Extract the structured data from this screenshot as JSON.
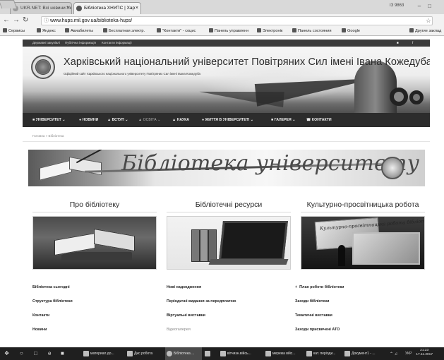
{
  "browser": {
    "tabs": [
      {
        "label": "UKR.NET: Всі новини Ук",
        "active": false
      },
      {
        "label": "Бібліотека ХНУПС | Хар",
        "active": true
      }
    ],
    "user_label": "ІЗ 9863",
    "url": "www.hups.mil.gov.ua/biblioteka-hups/",
    "bookmarks": [
      "Сервисы",
      "Яндекс",
      "Авиабилеты",
      "Бесплатная электр.",
      "\"Контакти\" - социс",
      "Панель управленн",
      "Электронік",
      "Панель состояния",
      "Google",
      "Другие заклад"
    ]
  },
  "site": {
    "top_links": [
      "Державні закупівлі",
      "Публічна інформація",
      "Контакти інформації"
    ],
    "title": "Харківський національний університет Повітряних Сил імені Івана Кожедуба",
    "subtitle": "Офіційний сайт Харківського національного університету Повітряних Сил імені Івана Кожедуба",
    "nav": [
      {
        "label": "УНІВЕРСИТЕТ ⌄",
        "muted": false
      },
      {
        "label": "НОВИНИ",
        "muted": false
      },
      {
        "label": "ВСТУП ⌄",
        "muted": false
      },
      {
        "label": "ОСВІТА ⌄",
        "muted": true
      },
      {
        "label": "НАУКА",
        "muted": false
      },
      {
        "label": "ЖИТТЯ В УНІВЕРСИТЕТІ ⌄",
        "muted": false
      },
      {
        "label": "ГАЛЕРЕЯ ⌄",
        "muted": false
      },
      {
        "label": "КОНТАКТИ",
        "muted": false
      }
    ],
    "breadcrumb": "Головна  »  Бібліотека"
  },
  "banner": {
    "title": "Бібліотека університету"
  },
  "columns": [
    {
      "title": "Про бібліотеку",
      "links": [
        {
          "label": "Бібліотека сьогодні",
          "muted": false
        },
        {
          "label": "Структура бібліотеки",
          "muted": false
        },
        {
          "label": "Контакти",
          "muted": false
        },
        {
          "label": "Новини",
          "muted": false
        }
      ]
    },
    {
      "title": "Бібліотечні ресурси",
      "links": [
        {
          "label": "Нові надходження",
          "muted": false
        },
        {
          "label": "Періодичні видання за передплатою",
          "muted": false
        },
        {
          "label": "Віртуальні виставки",
          "muted": false
        },
        {
          "label": "Відеогалерея",
          "muted": true
        }
      ]
    },
    {
      "title": "Культурно-просвітницька робота",
      "links": [
        {
          "label": "План роботи бібліотеки",
          "muted": false,
          "prefix": "+"
        },
        {
          "label": "Заходи бібліотеки",
          "muted": false
        },
        {
          "label": "Тематичні виставки",
          "muted": false
        },
        {
          "label": "Заходи присвячені АТО",
          "muted": false
        }
      ],
      "image_caption": "Культурно-просвітницька робота бібліотеки"
    }
  ],
  "taskbar": {
    "items": [
      {
        "label": "материал до...",
        "active": false
      },
      {
        "label": "Дис.робота",
        "active": false
      },
      {
        "label": "Бібліотека ...",
        "active": true
      },
      {
        "label": "",
        "active": false
      },
      {
        "label": "вітчизн.війсь...",
        "active": false
      },
      {
        "label": "мережа війс...",
        "active": false
      },
      {
        "label": "кат. періоди...",
        "active": false
      },
      {
        "label": "Документ1 - ...",
        "active": false
      }
    ],
    "lang": "УКР",
    "time": "21:23",
    "date": "17.11.2017"
  }
}
